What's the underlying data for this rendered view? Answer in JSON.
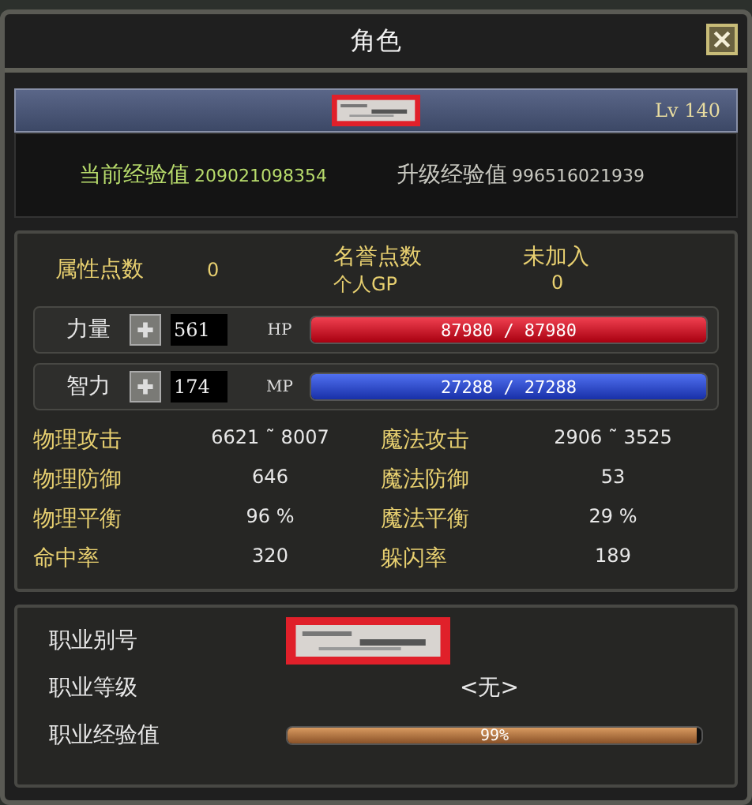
{
  "window": {
    "title": "角色"
  },
  "character": {
    "level": "Lv 140"
  },
  "experience": {
    "current_label": "当前经验值",
    "current_value": "209021098354",
    "next_label": "升级经验值",
    "next_value": "996516021939"
  },
  "points": {
    "attribute_label": "属性点数",
    "attribute_value": "0",
    "honor_label": "名誉点数",
    "honor_value": "未加入",
    "gp_label": "个人GP",
    "gp_value": "0"
  },
  "attributes": [
    {
      "label": "力量",
      "value": "561",
      "bar_label": "HP",
      "kind": "hp",
      "level": 1,
      "reading": "87980 / 87980"
    },
    {
      "label": "智力",
      "value": "174",
      "bar_label": "MP",
      "kind": "mp",
      "level": 1,
      "reading": "27288 / 27288"
    }
  ],
  "combat_stats": [
    {
      "label": "物理攻击",
      "value": "6621 ˜ 8007"
    },
    {
      "label": "魔法攻击",
      "value": "2906 ˜ 3525"
    },
    {
      "label": "物理防御",
      "value": "646"
    },
    {
      "label": "魔法防御",
      "value": "53"
    },
    {
      "label": "物理平衡",
      "value": "96 %"
    },
    {
      "label": "魔法平衡",
      "value": "29 %"
    },
    {
      "label": "命中率",
      "value": "320"
    },
    {
      "label": "躲闪率",
      "value": "189"
    }
  ],
  "job": {
    "alias_label": "职业别号",
    "grade_label": "职业等级",
    "grade_value": "<无>",
    "exp_label": "职业经验值",
    "level": 0.99,
    "reading": "99%"
  }
}
